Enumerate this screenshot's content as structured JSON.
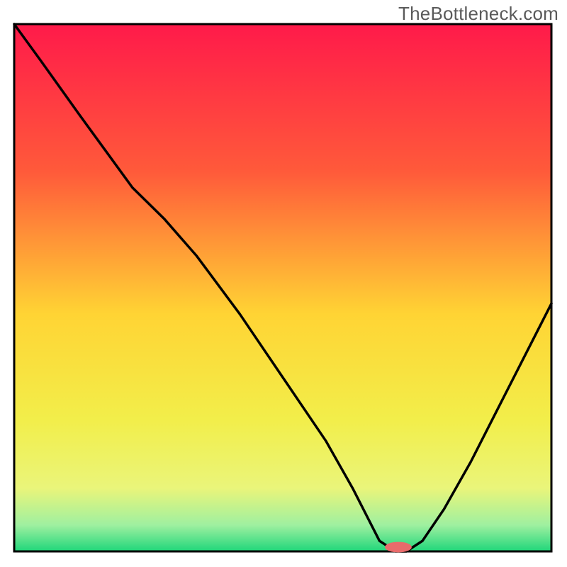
{
  "watermark": "TheBottleneck.com",
  "chart_data": {
    "type": "line",
    "title": "",
    "xlabel": "",
    "ylabel": "",
    "xlim": [
      0,
      100
    ],
    "ylim": [
      0,
      100
    ],
    "grid": false,
    "legend": false,
    "gradient_stops": [
      {
        "offset": 0.0,
        "color": "#ff1a4a"
      },
      {
        "offset": 0.28,
        "color": "#ff5a3a"
      },
      {
        "offset": 0.55,
        "color": "#ffd434"
      },
      {
        "offset": 0.75,
        "color": "#f2ee4a"
      },
      {
        "offset": 0.88,
        "color": "#eaf57a"
      },
      {
        "offset": 0.95,
        "color": "#9ff0a0"
      },
      {
        "offset": 1.0,
        "color": "#1fd67a"
      }
    ],
    "curve": {
      "x": [
        0,
        5,
        12,
        22,
        28,
        34,
        42,
        50,
        58,
        63,
        66,
        68,
        71,
        73,
        76,
        80,
        85,
        90,
        95,
        100
      ],
      "y": [
        100,
        93,
        83,
        69,
        63,
        56,
        45,
        33,
        21,
        12,
        6,
        2,
        0,
        0,
        2,
        8,
        17,
        27,
        37,
        47
      ]
    },
    "marker": {
      "x": 71.5,
      "y": 0.8,
      "color": "#e86b6b",
      "rx": 2.5,
      "ry": 1.0
    }
  }
}
